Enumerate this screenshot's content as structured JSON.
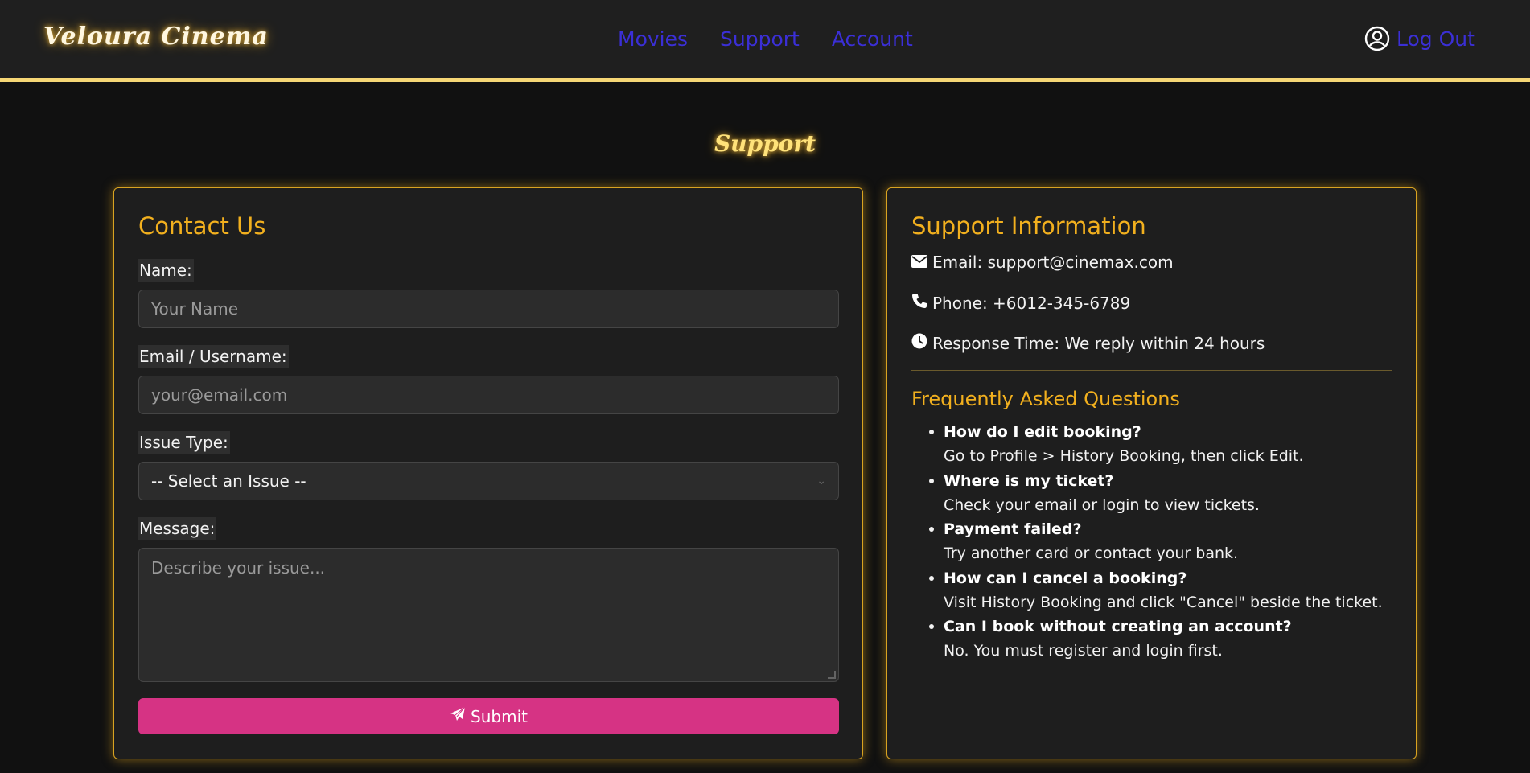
{
  "nav": {
    "logo": "Veloura Cinema",
    "links": [
      "Movies",
      "Support",
      "Account"
    ],
    "logout": "Log Out"
  },
  "page": {
    "title": "Support"
  },
  "contact": {
    "title": "Contact Us",
    "name_label": "Name:",
    "name_placeholder": "Your Name",
    "email_label": "Email / Username:",
    "email_placeholder": "your@email.com",
    "issue_label": "Issue Type:",
    "issue_selected": "-- Select an Issue --",
    "message_label": "Message:",
    "message_placeholder": "Describe your issue...",
    "submit": "Submit"
  },
  "info": {
    "title": "Support Information",
    "email": "Email: support@cinemax.com",
    "phone": "Phone: +6012-345-6789",
    "response": "Response Time: We reply within 24 hours",
    "faq_title": "Frequently Asked Questions",
    "faqs": [
      {
        "q": "How do I edit booking?",
        "a": "Go to Profile > History Booking, then click Edit."
      },
      {
        "q": "Where is my ticket?",
        "a": "Check your email or login to view tickets."
      },
      {
        "q": "Payment failed?",
        "a": "Try another card or contact your bank."
      },
      {
        "q": "How can I cancel a booking?",
        "a": "Visit History Booking and click \"Cancel\" beside the ticket."
      },
      {
        "q": "Can I book without creating an account?",
        "a": "No. You must register and login first."
      }
    ]
  },
  "colors": {
    "accent": "#f2b01e",
    "nav_link": "#3b2fd6",
    "submit": "#d63384",
    "header_rule": "#f6d776"
  }
}
